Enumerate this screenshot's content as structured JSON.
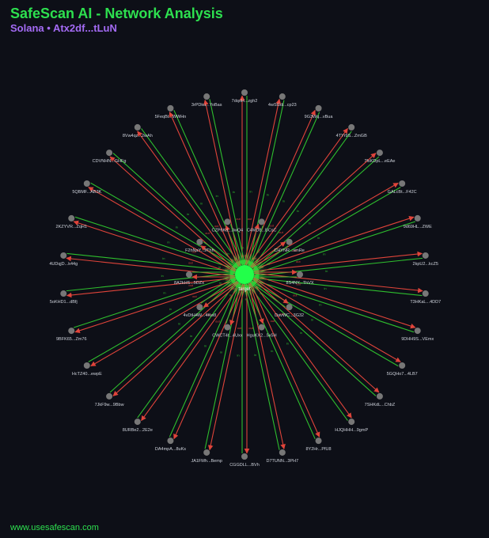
{
  "header": {
    "title": "SafeScan AI - Network Analysis",
    "chain": "Solana",
    "separator": "•",
    "address": "Atx2df...tLuN"
  },
  "footer": {
    "text": "www.usesafescan.com"
  },
  "colors": {
    "background": "#0d0f17",
    "title": "#2de04f",
    "subtitle": "#a46bf5",
    "center_node": "#22ff4a",
    "outer_node": "#777777",
    "incoming_edge": "#2ebf2e",
    "outgoing_edge": "#e0443a",
    "node_label": "#cfd3dc"
  },
  "graph": {
    "center": {
      "label": "target"
    },
    "outer_ring": [
      "7dqoH...zgh2",
      "4wSGdi...cp23",
      "9G3Wq...vBua",
      "4TYr9S...ZmGB",
      "7fsKDpL...eEAe",
      "GALcBt...F42C",
      "9d69HL...ZWE",
      "2kpU2...kcZ5",
      "T3HKaL...4DD7",
      "9DHH9S...VEmx",
      "5GQHo7...4LB7",
      "7SHKdL...ChbZ",
      "HJQHHH...9gmP",
      "8Y2Hr...PfU8",
      "D7TUNN...3PH7",
      "CGGDLL...BVh",
      "JA1FMh...Bemp",
      "DA4mpA...8uKs",
      "8URBe2...2E2e",
      "7JkF9w...9Bbw",
      "HcTZ40...ewpE",
      "9BFK65...Zm76",
      "5oKHD1...dBfj",
      "4UDqjD...k44g",
      "2KZYVR...ZqH1",
      "5QBMF...AB3K",
      "CDVNHN...GHFg",
      "8Vw4qz...2wAh",
      "5FeqBt...WWHn",
      "3rPDku...YoBas"
    ],
    "inner_ring": [
      "C4MD8...BCsC",
      "CHYNR...vmRe",
      "8S4NY...ThVX",
      "DavWC...3G32",
      "HguKX2...5x5H",
      "CWCT4t...4Uxx",
      "4vDtH4W...4Kw8",
      "8A2kHS...5DZx",
      "F2hNaY...9Thh",
      "CZP6Kd...3wQ4"
    ],
    "edge_labels": {
      "incoming": "in",
      "outgoing": "out"
    }
  }
}
